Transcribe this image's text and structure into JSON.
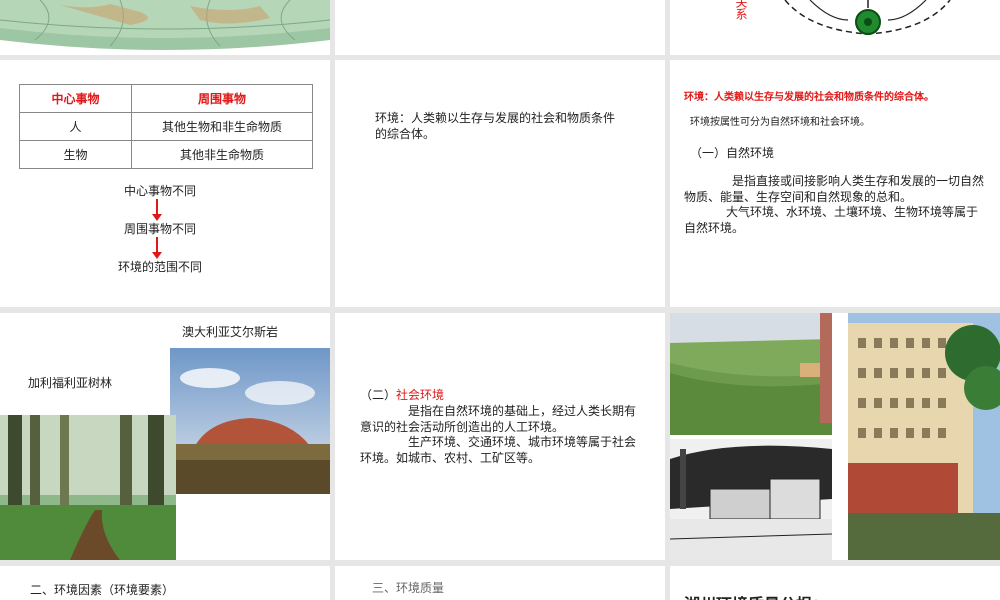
{
  "slide1": {
    "image": "globe-grid-illustration"
  },
  "slide3": {
    "vertical_text": "关系"
  },
  "slide4": {
    "table": {
      "headers": [
        "中心事物",
        "周围事物"
      ],
      "rows": [
        [
          "人",
          "其他生物和非生命物质"
        ],
        [
          "生物",
          "其他非生命物质"
        ]
      ]
    },
    "flow": [
      "中心事物不同",
      "周围事物不同",
      "环境的范围不同"
    ]
  },
  "slide5": {
    "text": "环境：人类赖以生存与发展的社会和物质条件的综合体。"
  },
  "slide6": {
    "definition": "环境：人类赖以生存与发展的社会和物质条件的综合体。",
    "classification": "环境按属性可分为自然环境和社会环境。",
    "heading": "（一）自然环境",
    "para1": "是指直接或间接影响人类生存和发展的一切自然物质、能量、生存空间和自然现象的总和。",
    "para2": "大气环境、水环境、土壤环境、生物环境等属于自然环境。"
  },
  "slide7": {
    "label_uluru": "澳大利亚艾尔斯岩",
    "label_forest": "加利福利亚树林"
  },
  "slide8": {
    "heading_prefix": "（二）",
    "heading_red": "社会环境",
    "para1": "是指在自然环境的基础上，经过人类长期有意识的社会活动所创造出的人工环境。",
    "para2": "生产环境、交通环境、城市环境等属于社会环境。如城市、农村、工矿区等。"
  },
  "slide10": {
    "text": "二、环境因素（环境要素）"
  },
  "slide11": {
    "text": "三、环境质量"
  },
  "slide12": {
    "text": "湖州环境质量公报："
  },
  "colors": {
    "accent_red": "#e01818",
    "border_gray": "#888888",
    "page_bg": "#e6e6e6"
  }
}
